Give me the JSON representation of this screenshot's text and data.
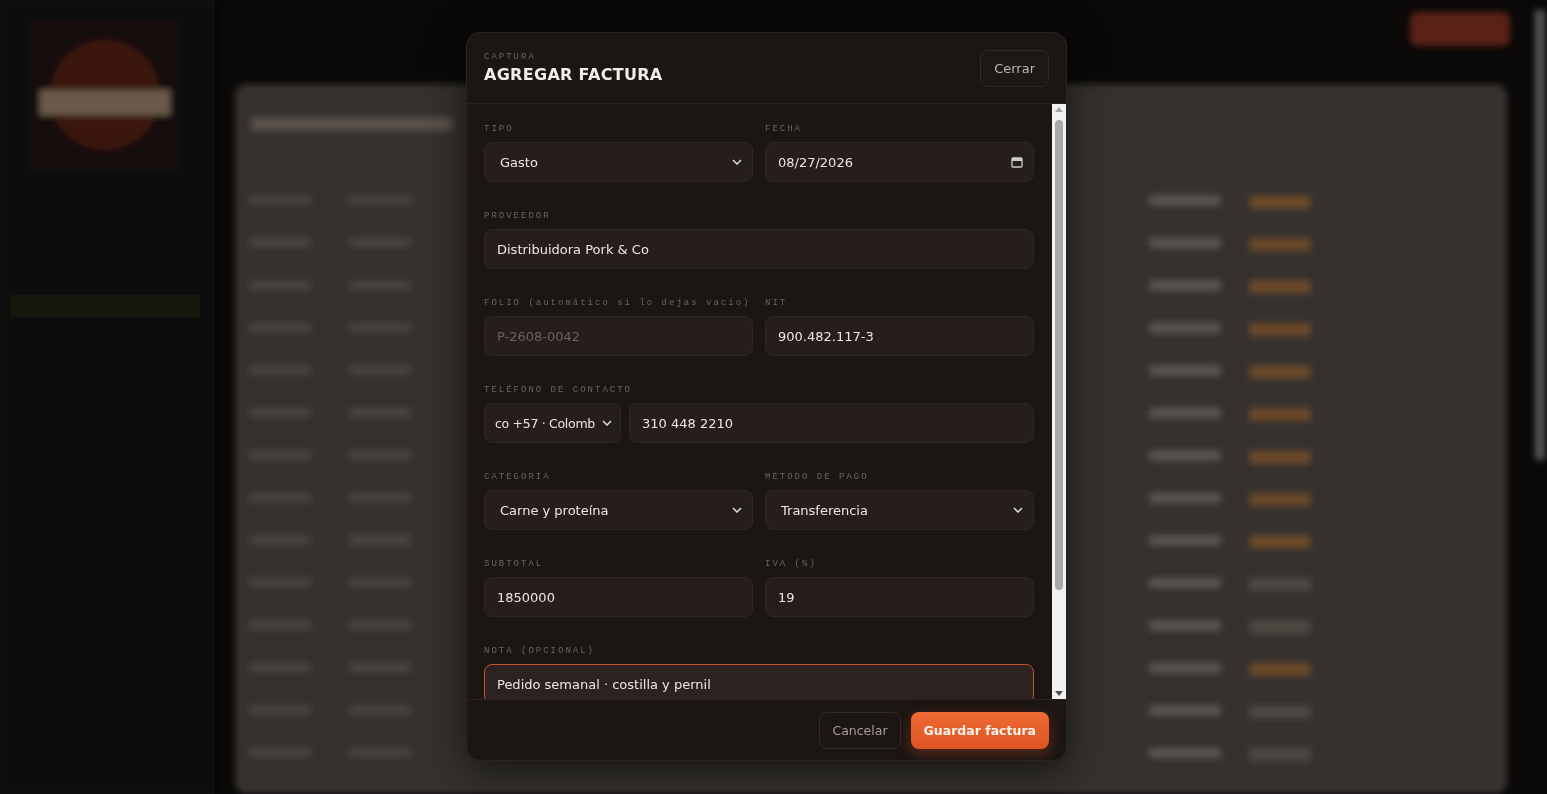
{
  "dialog": {
    "eyebrow": "CAPTURA",
    "title": "AGREGAR FACTURA",
    "close": "Cerrar"
  },
  "rows": [
    {
      "fields": [
        {
          "label": "TIPO",
          "controls": [
            {
              "kind": "select",
              "value": "Gasto"
            }
          ]
        },
        {
          "label": "FECHA",
          "controls": [
            {
              "kind": "date",
              "value": "08/27/2026"
            }
          ]
        }
      ]
    },
    {
      "fields": [
        {
          "label": "PROVEEDOR",
          "controls": [
            {
              "kind": "text",
              "value": "Distribuidora Pork & Co"
            }
          ]
        }
      ]
    },
    {
      "fields": [
        {
          "label": "FOLIO (automático si lo dejas vacío)",
          "controls": [
            {
              "kind": "text",
              "placeholder": "P-2608-0042"
            }
          ]
        },
        {
          "label": "NIT",
          "controls": [
            {
              "kind": "text",
              "value": "900.482.117-3"
            }
          ]
        }
      ]
    },
    {
      "fields": [
        {
          "label": "TELÉFONO DE CONTACTO",
          "controls": [
            {
              "kind": "select",
              "value": "co +57 · Colomb"
            },
            {
              "kind": "text",
              "value": "310 448 2210"
            }
          ]
        }
      ]
    },
    {
      "fields": [
        {
          "label": "CATEGORÍA",
          "controls": [
            {
              "kind": "select",
              "value": "Carne y proteína"
            }
          ]
        },
        {
          "label": "MÉTODO DE PAGO",
          "controls": [
            {
              "kind": "select",
              "value": "Transferencia"
            }
          ]
        }
      ]
    },
    {
      "fields": [
        {
          "label": "SUBTOTAL",
          "controls": [
            {
              "kind": "text",
              "value": "1850000"
            }
          ]
        },
        {
          "label": "IVA (%)",
          "controls": [
            {
              "kind": "text",
              "value": "19"
            }
          ]
        }
      ]
    },
    {
      "fields": [
        {
          "label": "NOTA (OPCIONAL)",
          "controls": [
            {
              "kind": "text",
              "value": "Pedido semanal · costilla y pernil",
              "focused": true
            }
          ]
        }
      ]
    }
  ],
  "footer": {
    "cancel": "Cancelar",
    "save": "Guardar factura"
  }
}
